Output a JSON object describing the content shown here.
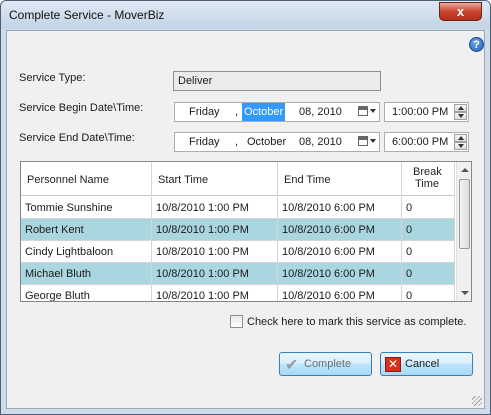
{
  "window": {
    "title": "Complete Service - MoverBiz",
    "close_label": "x",
    "help_label": "?"
  },
  "form": {
    "service_type_label": "Service Type:",
    "service_type_value": "Deliver",
    "begin_label": "Service Begin Date\\Time:",
    "end_label": "Service End Date\\Time:",
    "begin": {
      "weekday": "Friday",
      "sep": ",",
      "month": "October",
      "day_year": "08, 2010",
      "time": "1:00:00 PM"
    },
    "end": {
      "weekday": "Friday",
      "sep": ",",
      "month": "October",
      "day_year": "08, 2010",
      "time": "6:00:00 PM"
    }
  },
  "grid": {
    "columns": [
      "Personnel Name",
      "Start Time",
      "End Time",
      "Break Time"
    ],
    "rows": [
      {
        "name": "Tommie Sunshine",
        "start": "10/8/2010 1:00 PM",
        "end": "10/8/2010 6:00 PM",
        "break": "0"
      },
      {
        "name": "Robert Kent",
        "start": "10/8/2010 1:00 PM",
        "end": "10/8/2010 6:00 PM",
        "break": "0"
      },
      {
        "name": "Cindy Lightbaloon",
        "start": "10/8/2010 1:00 PM",
        "end": "10/8/2010 6:00 PM",
        "break": "0"
      },
      {
        "name": "Michael Bluth",
        "start": "10/8/2010 1:00 PM",
        "end": "10/8/2010 6:00 PM",
        "break": "0"
      },
      {
        "name": "George Bluth",
        "start": "10/8/2010 1:00 PM",
        "end": "10/8/2010 6:00 PM",
        "break": "0"
      }
    ]
  },
  "complete_checkbox_label": "Check here to mark this service as complete.",
  "buttons": {
    "complete": "Complete",
    "cancel": "Cancel"
  },
  "colors": {
    "alt_row": "#aad6e0",
    "selection": "#3399ff"
  }
}
